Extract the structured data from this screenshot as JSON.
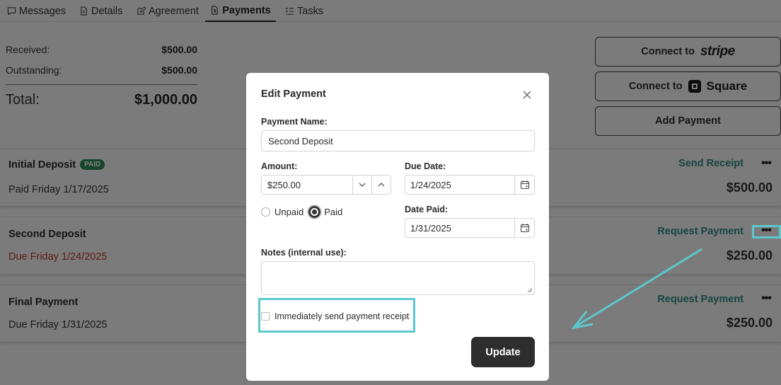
{
  "tabs": [
    {
      "label": "Messages",
      "icon": "message-icon"
    },
    {
      "label": "Details",
      "icon": "document-icon"
    },
    {
      "label": "Agreement",
      "icon": "edit-icon"
    },
    {
      "label": "Payments",
      "icon": "dollar-doc-icon",
      "active": true
    },
    {
      "label": "Tasks",
      "icon": "checklist-icon"
    }
  ],
  "summary": {
    "received_label": "Received:",
    "received_value": "$500.00",
    "outstanding_label": "Outstanding:",
    "outstanding_value": "$500.00",
    "total_label": "Total:",
    "total_value": "$1,000.00"
  },
  "actions": {
    "connect_stripe": "Connect to",
    "stripe_brand": "stripe",
    "connect_square": "Connect to",
    "square_brand": "Square",
    "add_payment": "Add Payment"
  },
  "payments": [
    {
      "name": "Initial Deposit",
      "badge": "PAID",
      "date": "Paid Friday 1/17/2025",
      "action": "Send Receipt",
      "amount": "$500.00",
      "menu": "•••"
    },
    {
      "name": "Second Deposit",
      "date": "Due Friday 1/24/2025",
      "action": "Request Payment",
      "amount": "$250.00",
      "menu": "•••",
      "overdue": true
    },
    {
      "name": "Final Payment",
      "date": "Due Friday 1/31/2025",
      "action": "Request Payment",
      "amount": "$250.00",
      "menu": "•••"
    }
  ],
  "modal": {
    "title": "Edit Payment",
    "payment_name_label": "Payment Name:",
    "payment_name_value": "Second Deposit",
    "amount_label": "Amount:",
    "amount_value": "$250.00",
    "due_date_label": "Due Date:",
    "due_date_value": "1/24/2025",
    "status_unpaid": "Unpaid",
    "status_paid": "Paid",
    "status_selected": "Paid",
    "date_paid_label": "Date Paid:",
    "date_paid_value": "1/31/2025",
    "notes_label": "Notes (internal use):",
    "notes_value": "",
    "send_receipt_label": "Immediately send payment receipt",
    "send_receipt_checked": false,
    "update_label": "Update"
  },
  "colors": {
    "accent_teal": "#2e8b84",
    "paid_badge": "#2e8b57",
    "overdue_red": "#c0392b",
    "highlight": "#5cc8cc"
  }
}
